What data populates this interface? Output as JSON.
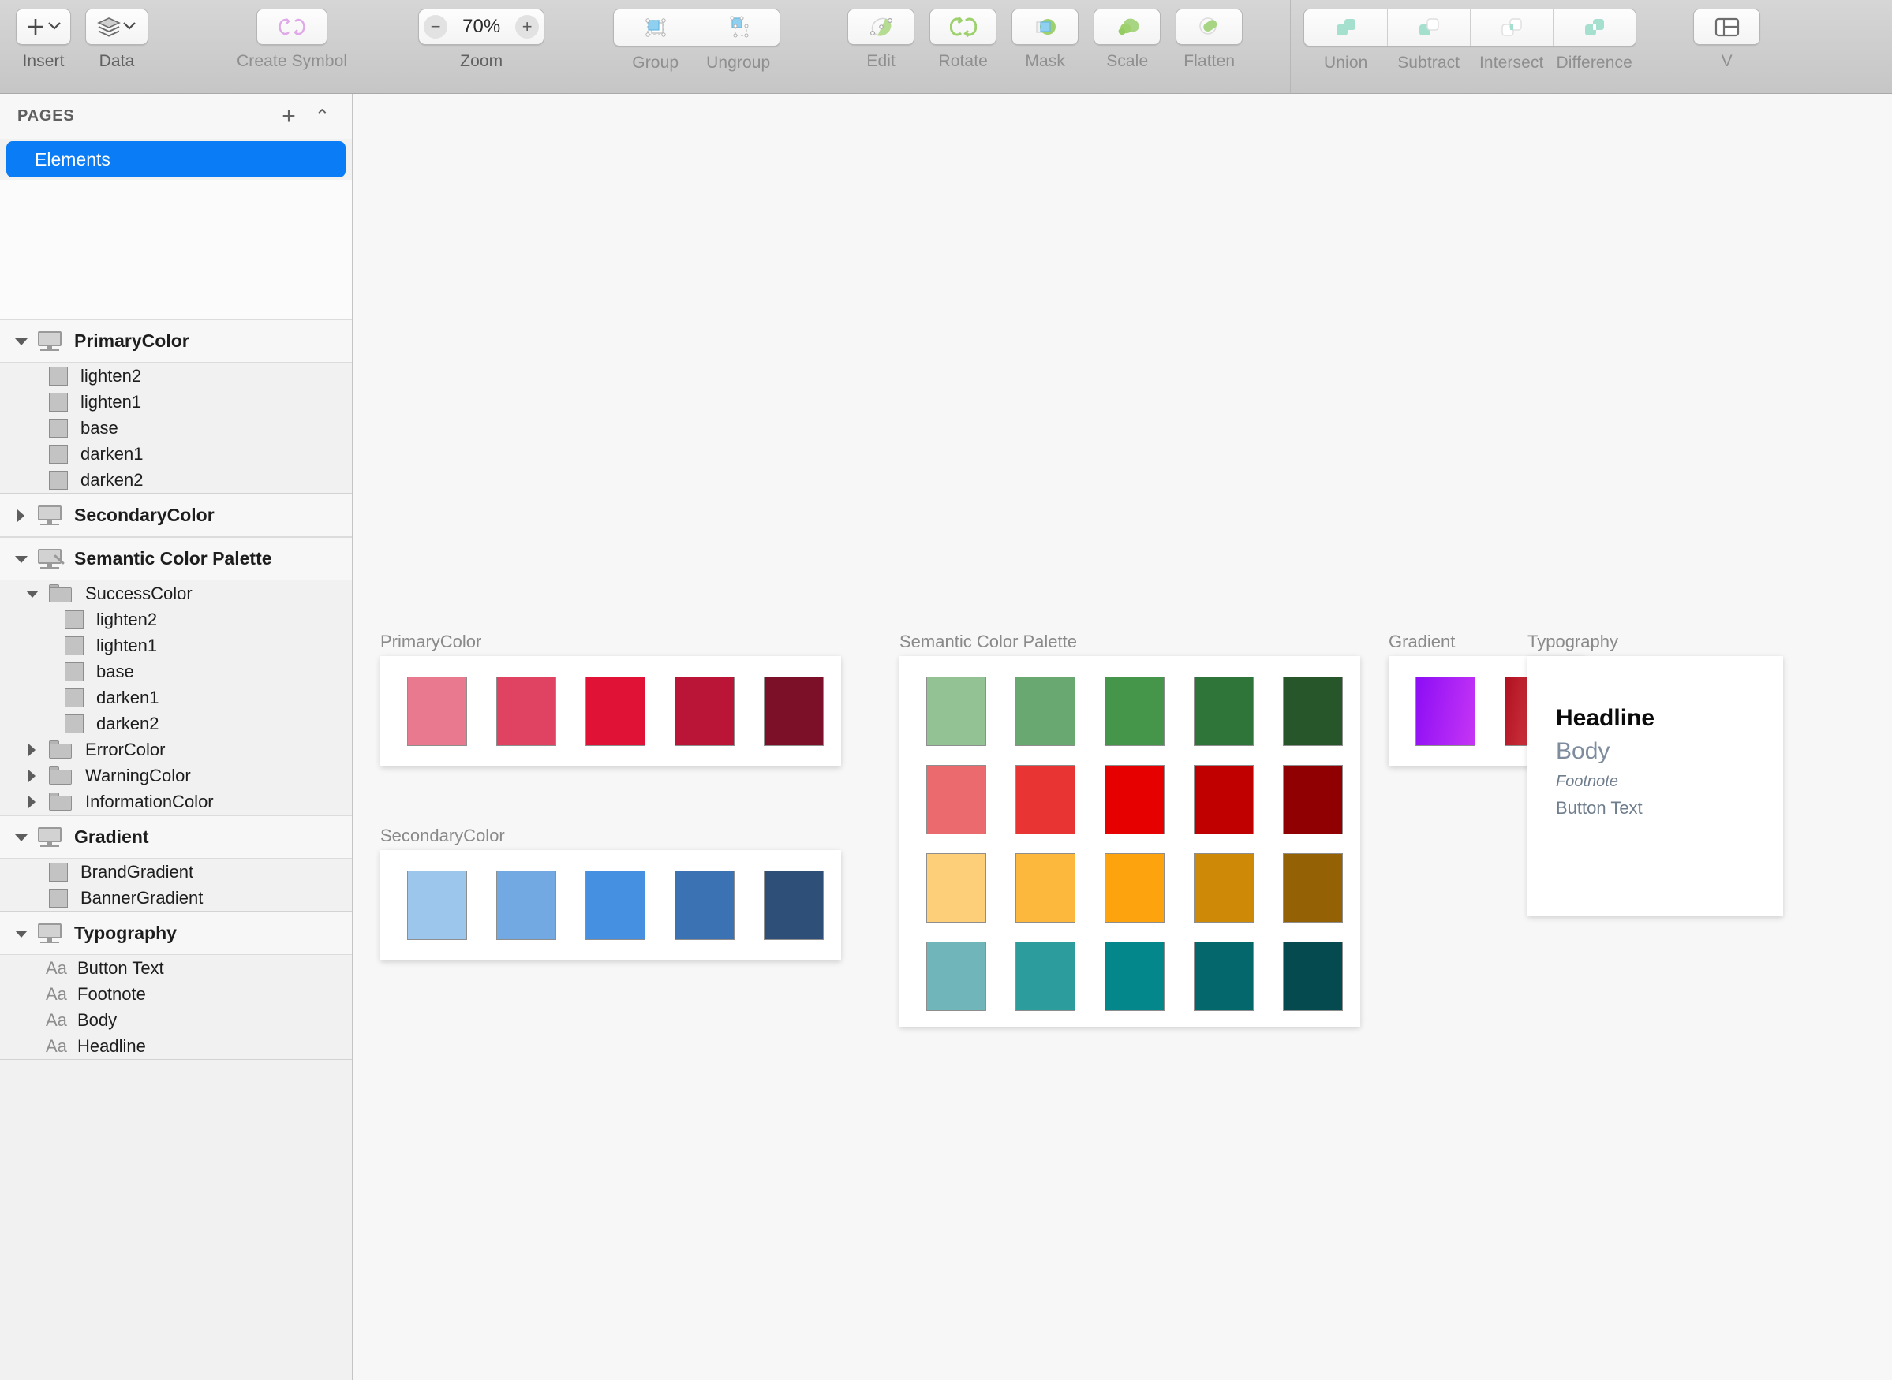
{
  "toolbar": {
    "groups": [
      {
        "label": "Insert",
        "dim": false,
        "icon": "plus-icon"
      },
      {
        "label": "Data",
        "dim": false,
        "icon": "layers-icon"
      },
      {
        "label": "Create Symbol",
        "dim": true,
        "icon": "symbol-refresh-icon"
      },
      {
        "label": "Zoom",
        "dim": false,
        "icon": "zoom-stepper"
      },
      {
        "label": "Group",
        "dim": true,
        "icon": "group-icon"
      },
      {
        "label": "Ungroup",
        "dim": true,
        "icon": "ungroup-icon"
      },
      {
        "label": "Edit",
        "dim": true,
        "icon": "edit-node-icon"
      },
      {
        "label": "Rotate",
        "dim": true,
        "icon": "rotate-icon"
      },
      {
        "label": "Mask",
        "dim": true,
        "icon": "mask-icon"
      },
      {
        "label": "Scale",
        "dim": true,
        "icon": "scale-icon"
      },
      {
        "label": "Flatten",
        "dim": true,
        "icon": "flatten-icon"
      },
      {
        "label": "Union",
        "dim": true,
        "icon": "union-icon"
      },
      {
        "label": "Subtract",
        "dim": true,
        "icon": "subtract-icon"
      },
      {
        "label": "Intersect",
        "dim": true,
        "icon": "intersect-icon"
      },
      {
        "label": "Difference",
        "dim": true,
        "icon": "difference-icon"
      },
      {
        "label": "V",
        "dim": true,
        "icon": "view-panels-icon"
      }
    ],
    "zoom_value": "70%",
    "zoom_out_symbol": "−",
    "zoom_in_symbol": "+",
    "insert_label": "Insert",
    "data_label": "Data",
    "create_symbol_label": "Create Symbol",
    "zoom_label": "Zoom",
    "group_label": "Group",
    "ungroup_label": "Ungroup",
    "edit_label": "Edit",
    "rotate_label": "Rotate",
    "mask_label": "Mask",
    "scale_label": "Scale",
    "flatten_label": "Flatten",
    "union_label": "Union",
    "subtract_label": "Subtract",
    "intersect_label": "Intersect",
    "difference_label": "Difference",
    "view_label": "V"
  },
  "sidebar": {
    "pages_header": "PAGES",
    "add_icon": "+",
    "collapse_icon": "⌃",
    "pages": [
      {
        "label": "Elements",
        "selected": true
      }
    ],
    "selection_color": "#0a7cf6",
    "tree": [
      {
        "type": "artboard",
        "label": "PrimaryColor",
        "expanded": true,
        "children": [
          {
            "type": "swatch",
            "label": "lighten2"
          },
          {
            "type": "swatch",
            "label": "lighten1"
          },
          {
            "type": "swatch",
            "label": "base"
          },
          {
            "type": "swatch",
            "label": "darken1"
          },
          {
            "type": "swatch",
            "label": "darken2"
          }
        ]
      },
      {
        "type": "artboard",
        "label": "SecondaryColor",
        "expanded": false,
        "children": []
      },
      {
        "type": "artboard",
        "label": "Semantic Color Palette",
        "expanded": true,
        "edited": true,
        "children": [
          {
            "type": "folder",
            "label": "SuccessColor",
            "expanded": true,
            "children": [
              {
                "type": "swatch",
                "label": "lighten2"
              },
              {
                "type": "swatch",
                "label": "lighten1"
              },
              {
                "type": "swatch",
                "label": "base"
              },
              {
                "type": "swatch",
                "label": "darken1"
              },
              {
                "type": "swatch",
                "label": "darken2"
              }
            ]
          },
          {
            "type": "folder",
            "label": "ErrorColor",
            "expanded": false,
            "children": []
          },
          {
            "type": "folder",
            "label": "WarningColor",
            "expanded": false,
            "children": []
          },
          {
            "type": "folder",
            "label": "InformationColor",
            "expanded": false,
            "children": []
          }
        ]
      },
      {
        "type": "artboard",
        "label": "Gradient",
        "expanded": true,
        "children": [
          {
            "type": "swatch",
            "label": "BrandGradient"
          },
          {
            "type": "swatch",
            "label": "BannerGradient"
          }
        ]
      },
      {
        "type": "artboard",
        "label": "Typography",
        "expanded": true,
        "children": [
          {
            "type": "text",
            "label": "Button Text"
          },
          {
            "type": "text",
            "label": "Footnote"
          },
          {
            "type": "text",
            "label": "Body"
          },
          {
            "type": "text",
            "label": "Headline"
          }
        ]
      }
    ]
  },
  "canvas": {
    "artboards": [
      {
        "name": "PrimaryColor",
        "swatches": [
          "#e9798f",
          "#e04262",
          "#e01336",
          "#ba1436",
          "#7d1029"
        ]
      },
      {
        "name": "SecondaryColor",
        "swatches": [
          "#9dc6ec",
          "#72a9e3",
          "#4590e0",
          "#3a72b4",
          "#2d4f78"
        ]
      },
      {
        "name": "Semantic Color Palette",
        "rows": [
          {
            "name": "SuccessColor",
            "swatches": [
              "#93c295",
              "#69a971",
              "#45954a",
              "#2f7438",
              "#27562b"
            ]
          },
          {
            "name": "ErrorColor",
            "swatches": [
              "#ea6a6d",
              "#e93434",
              "#e70000",
              "#c00000",
              "#900003"
            ]
          },
          {
            "name": "WarningColor",
            "swatches": [
              "#fccf78",
              "#fbb83c",
              "#fca30d",
              "#ce8a07",
              "#946105"
            ]
          },
          {
            "name": "InformationColor",
            "swatches": [
              "#6fb5b9",
              "#2c9c9c",
              "#04878a",
              "#04676b",
              "#044a4e"
            ]
          }
        ]
      },
      {
        "name": "Gradient",
        "swatches": [
          {
            "label": "BrandGradient",
            "from": "#8c0ef5",
            "to": "#c635f5"
          },
          {
            "label": "BannerGradient",
            "from": "#b01020",
            "to": "#e8555a"
          }
        ]
      },
      {
        "name": "Typography",
        "items": [
          {
            "label": "Headline",
            "style": "headline"
          },
          {
            "label": "Body",
            "style": "body"
          },
          {
            "label": "Footnote",
            "style": "footnote"
          },
          {
            "label": "Button Text",
            "style": "button"
          }
        ]
      }
    ]
  }
}
